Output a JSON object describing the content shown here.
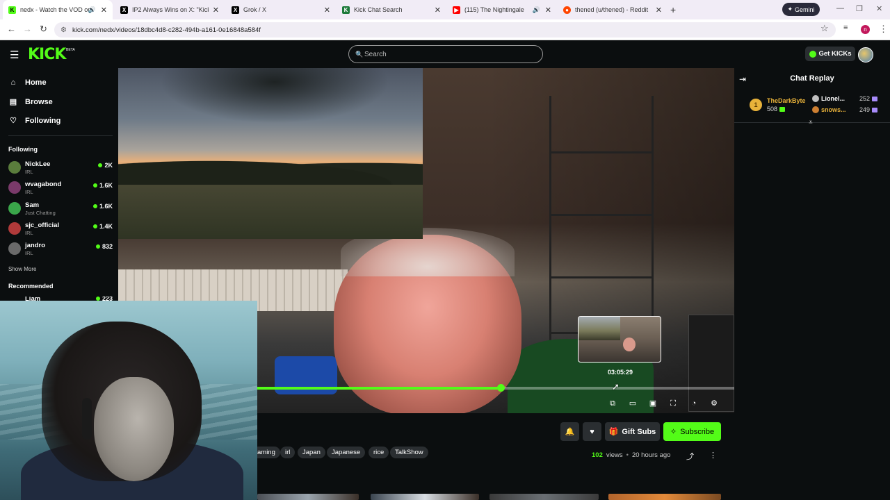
{
  "browser": {
    "tabs": [
      {
        "label": "nedx - Watch the VOD on K",
        "favicon": "kick-icon",
        "color": "#53fc18",
        "active": true,
        "sound": true
      },
      {
        "label": "IP2 Always Wins on X: \"Kick Stre",
        "favicon": "x-icon",
        "color": "#000000",
        "active": false,
        "sound": false
      },
      {
        "label": "Grok / X",
        "favicon": "x-icon",
        "color": "#000000",
        "active": false,
        "sound": false
      },
      {
        "label": "Kick Chat Search",
        "favicon": "kick-icon",
        "color": "#1d7a3a",
        "active": false,
        "sound": false
      },
      {
        "label": "(115) The Nightingale - You",
        "favicon": "youtube-icon",
        "color": "#ff0000",
        "active": false,
        "sound": true
      },
      {
        "label": "thened (u/thened) - Reddit",
        "favicon": "reddit-icon",
        "color": "#ff4500",
        "active": false,
        "sound": false
      }
    ],
    "gemini_label": "Gemini",
    "url": "kick.com/nedx/videos/18dbc4d8-c282-494b-a161-0e16848a584f",
    "profile_initial": "n"
  },
  "header": {
    "logo": "KICK",
    "logo_badge": "BETA",
    "search_placeholder": "Search",
    "get_kicks_label": "Get KICKs"
  },
  "sidebar": {
    "nav": [
      {
        "label": "Home",
        "icon": "home-icon"
      },
      {
        "label": "Browse",
        "icon": "browse-icon"
      },
      {
        "label": "Following",
        "icon": "heart-icon"
      }
    ],
    "following_heading": "Following",
    "channels": [
      {
        "name": "NickLee",
        "category": "IRL",
        "viewers": "2K",
        "avatar_color": "#5a7d3c"
      },
      {
        "name": "wvagabond",
        "category": "IRL",
        "viewers": "1.6K",
        "avatar_color": "#7a3a6a"
      },
      {
        "name": "Sam",
        "category": "Just Chatting",
        "viewers": "1.6K",
        "avatar_color": "#3aa64a"
      },
      {
        "name": "sjc_official",
        "category": "IRL",
        "viewers": "1.4K",
        "avatar_color": "#b03a3a"
      },
      {
        "name": "jandro",
        "category": "IRL",
        "viewers": "832",
        "avatar_color": "#6a6a6a"
      }
    ],
    "show_more": "Show More",
    "recommended_heading": "Recommended",
    "recommended_partial": {
      "name": "Liam",
      "viewers": "223"
    }
  },
  "player": {
    "progress": 0.51,
    "preview_time": "03:05:29",
    "controls": [
      "pip-icon",
      "clip-icon",
      "theater-icon",
      "fullscreen-icon",
      "playback-speed-icon",
      "settings-icon"
    ],
    "accent": "#53fc18"
  },
  "chat": {
    "title": "Chat Replay",
    "top_gifter": {
      "rank": "1",
      "name": "TheDarkByte",
      "count": "508"
    },
    "gifters": [
      {
        "name": "Lionel...",
        "count": "252"
      },
      {
        "name": "snows...",
        "count": "249"
      }
    ]
  },
  "actions": {
    "gift_subs": "Gift Subs",
    "subscribe": "Subscribe"
  },
  "tags": [
    "aming",
    "irl",
    "Japan",
    "Japanese",
    "rice",
    "TalkShow"
  ],
  "stats": {
    "views_count": "102",
    "views_label": "views",
    "time_ago": "20 hours ago"
  }
}
